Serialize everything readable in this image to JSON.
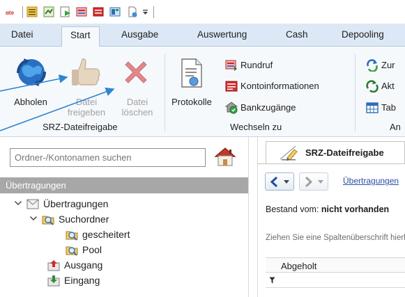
{
  "quick_access": {
    "icons": [
      "app-logo-icon",
      "separator",
      "list-icon",
      "grid-icon",
      "run-icon",
      "tools-icon",
      "card-icon",
      "panel-icon",
      "document-icon",
      "qat-dropdown-icon"
    ]
  },
  "tabs": [
    {
      "label": "Datei"
    },
    {
      "label": "Start",
      "active": true
    },
    {
      "label": "Ausgabe"
    },
    {
      "label": "Auswertung"
    },
    {
      "label": "Cash"
    },
    {
      "label": "Depooling"
    }
  ],
  "ribbon": {
    "srz_group": {
      "label": "SRZ-Dateifreigabe",
      "abholen": {
        "label": "Abholen",
        "icon": "globe-sync-icon"
      },
      "freigeben": {
        "line1": "Datei",
        "line2": "freigeben",
        "icon": "thumbs-up-icon",
        "disabled": true
      },
      "loeschen": {
        "line1": "Datei",
        "line2": "löschen",
        "icon": "red-x-icon",
        "disabled": true
      }
    },
    "wechseln_group": {
      "label": "Wechseln zu",
      "protokolle": {
        "label": "Protokolle",
        "icon": "protocol-document-icon"
      },
      "items": [
        {
          "label": "Rundruf",
          "icon": "broadcast-icon"
        },
        {
          "label": "Kontoinformationen",
          "icon": "account-info-icon"
        },
        {
          "label": "Bankzugänge",
          "icon": "bank-access-icon"
        }
      ]
    },
    "third_group": {
      "label": "An",
      "items": [
        {
          "label": "Zur",
          "icon": "refresh-icon"
        },
        {
          "label": "Akt",
          "icon": "update-icon"
        },
        {
          "label": "Tab",
          "icon": "table-icon"
        }
      ]
    }
  },
  "nav": {
    "search_placeholder": "Ordner-/Kontonamen suchen",
    "header": "Übertragungen",
    "tree": [
      {
        "label": "Übertragungen",
        "icon": "transfer-folder-icon"
      },
      {
        "label": "Suchordner",
        "icon": "search-folder-icon"
      },
      {
        "label": "gescheitert",
        "icon": "search-folder-icon"
      },
      {
        "label": "Pool",
        "icon": "search-folder-icon"
      },
      {
        "label": "Ausgang",
        "icon": "outbox-icon"
      },
      {
        "label": "Eingang",
        "icon": "inbox-icon"
      }
    ]
  },
  "document": {
    "tab_title": "SRZ-Dateifreigabe",
    "breadcrumb": "Übertragungen",
    "bestand_prefix": "Bestand vom:",
    "bestand_value": "nicht vorhanden",
    "group_hint": "Ziehen Sie eine Spaltenüberschrift hierher",
    "column_header": "Abgeholt"
  },
  "colors": {
    "tab_bar": "#dce8f5",
    "ribbon_bg": "#f6f9fc",
    "nav_header": "#a7a7a7",
    "arrow": "#2f86d0",
    "link": "#2a4ea1"
  }
}
